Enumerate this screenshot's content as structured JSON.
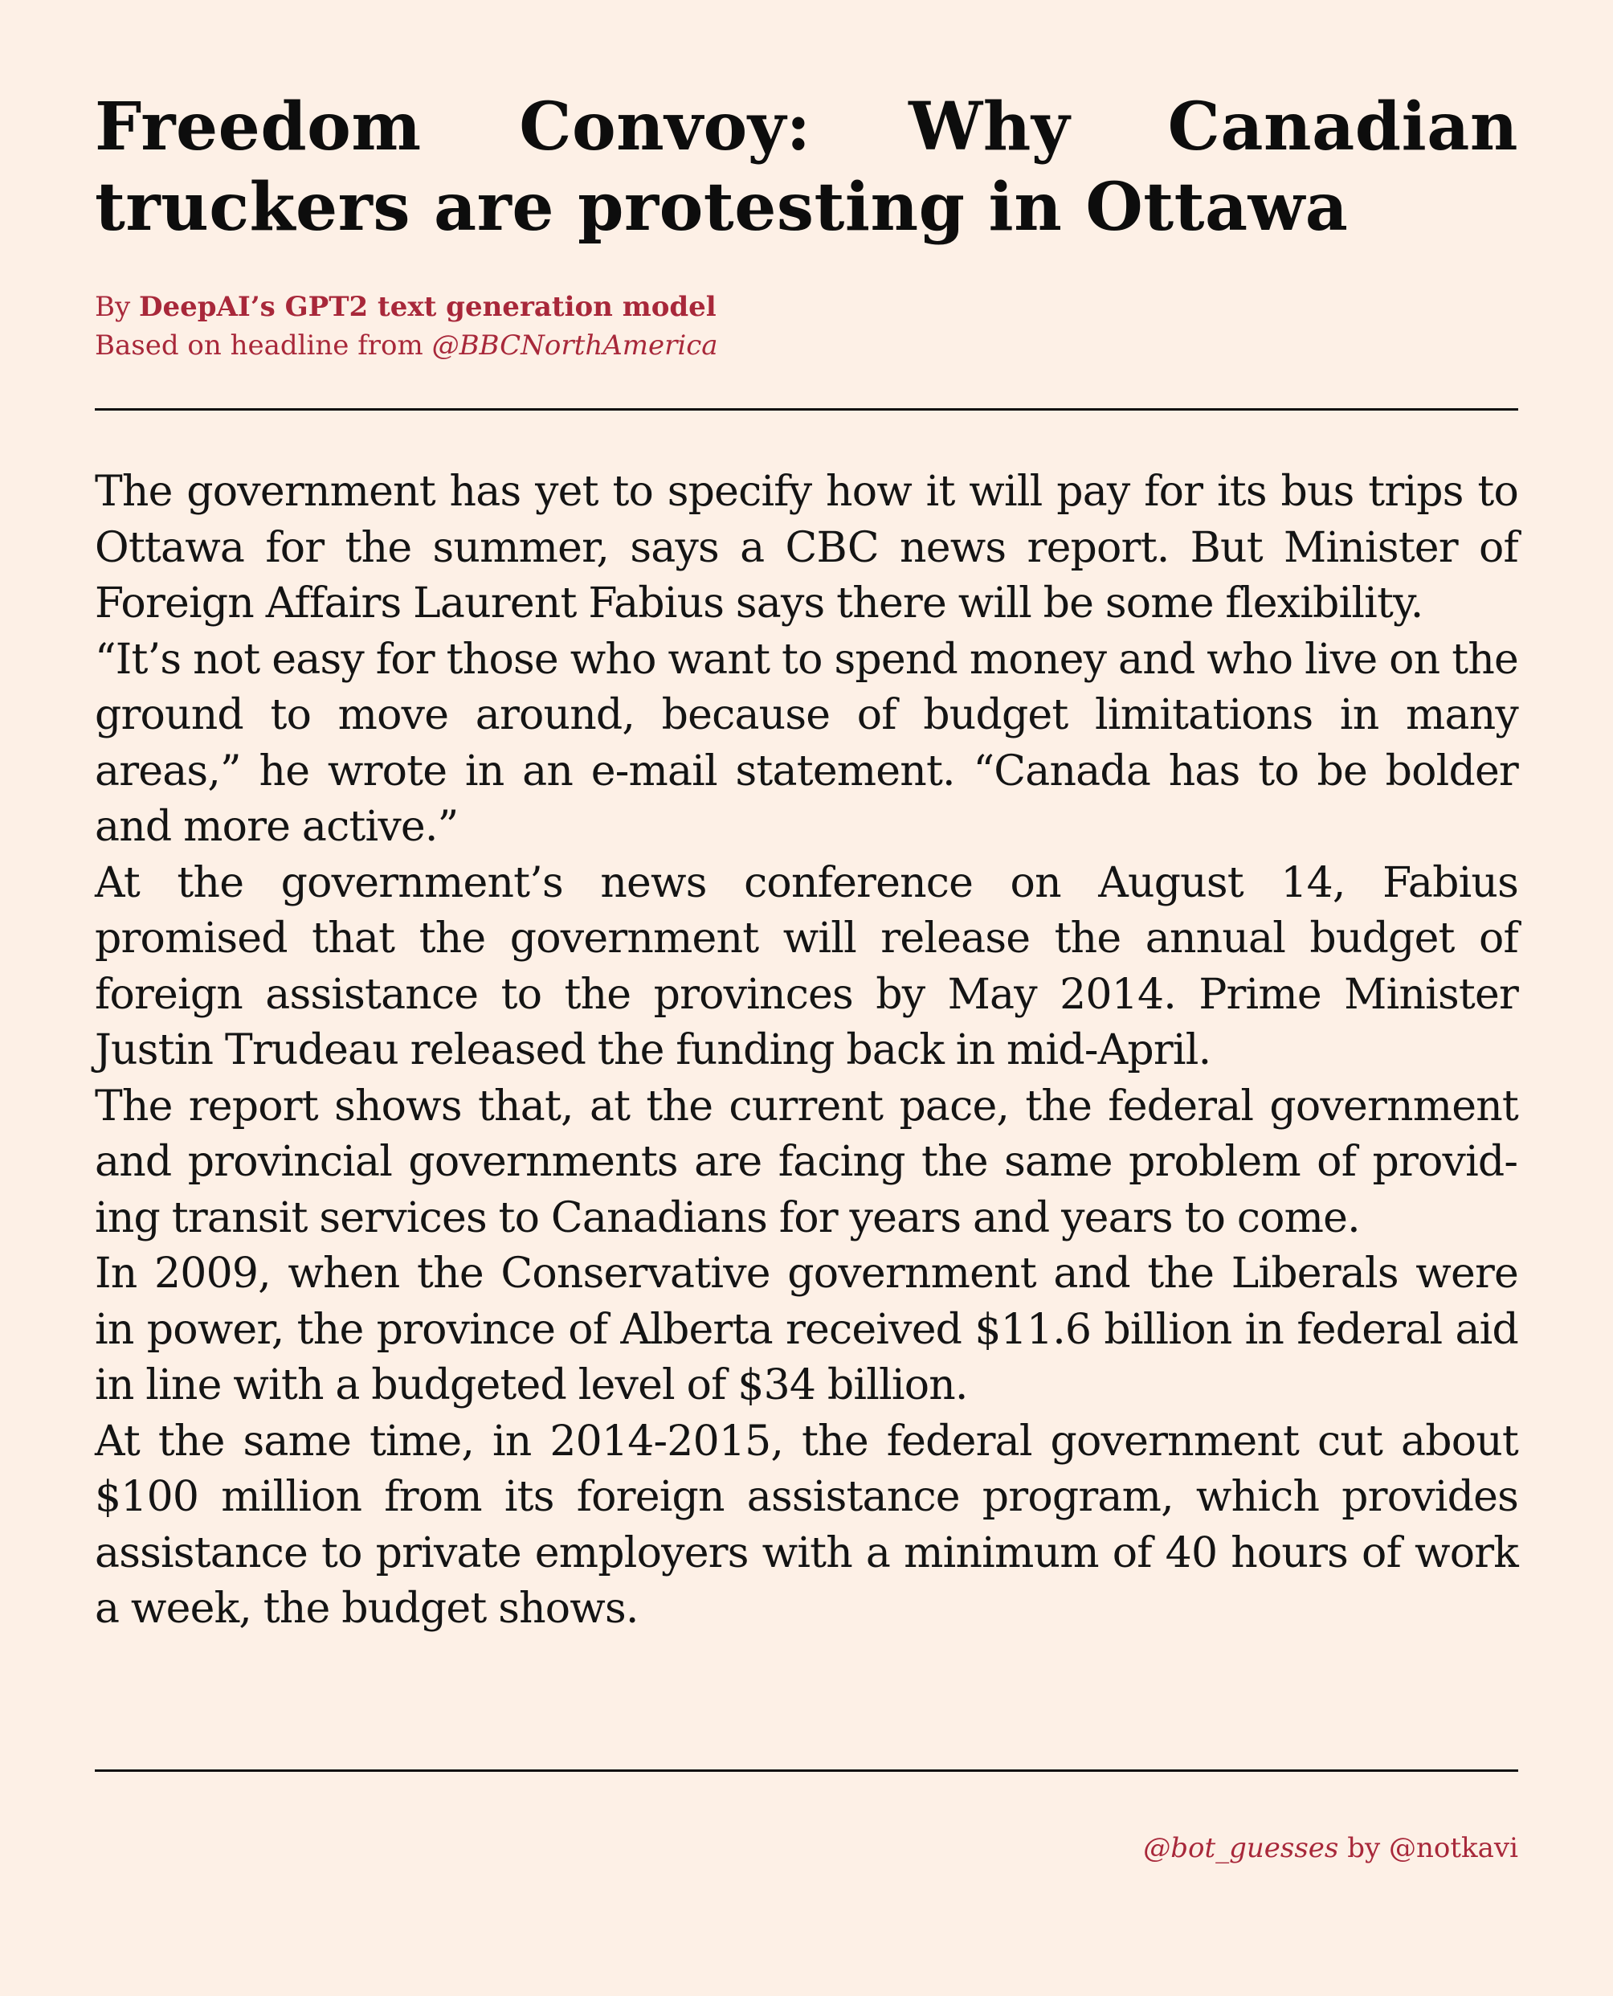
{
  "headline": "Freedom Convoy: Why Canadian truckers are protesting in Ottawa",
  "byline": {
    "by_prefix": "By",
    "author": "DeepAI’s GPT2 text generation model",
    "based_on_prefix": "Based on headline from",
    "source_handle": "@BBCNorthAmerica"
  },
  "article": {
    "paragraphs": [
      "The government has yet to specify how it will pay for its bus trips to Ottawa for the summer, says a CBC news report. But Minister of Foreign Affairs Laurent Fabius says there will be some flexibility.",
      "“It’s not easy for those who want to spend money and who live on the ground to move around, because of budget limitations in many areas,” he wrote in an e-mail statement. “Canada has to be bolder and more active.”",
      "At the government’s news conference on August 14, Fabius promised that the government will release the annual budget of foreign assis­tance to the provinces by May 2014. Prime Minister Justin Trudeau released the funding back in mid-April.",
      "The report shows that, at the current pace, the federal government and provincial governments are facing the same problem of provid­ing transit services to Canadians for years and years to come.",
      "In 2009, when the Conservative government and the Liberals were in power, the province of Alberta received $11.6 billion in federal aid in line with a budgeted level of $34 billion.",
      "At the same time, in 2014-2015, the federal government cut about $100 million from its foreign assistance program, which provides assistance to private employers with a minimum of 40 hours of work a week, the budget shows."
    ]
  },
  "footer": {
    "bot_handle": "@bot_guesses",
    "by_word": "by",
    "creator_handle": "@notkavi"
  },
  "colors": {
    "background": "#fdf0e6",
    "text": "#111111",
    "accent": "#a8283a"
  }
}
